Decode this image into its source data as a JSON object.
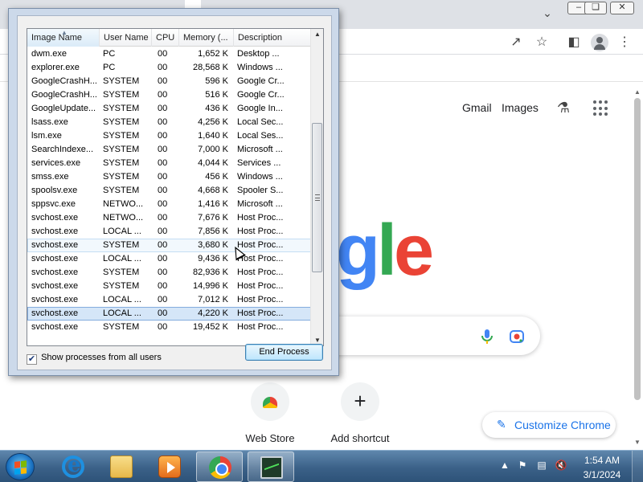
{
  "chrome": {
    "top_links": {
      "gmail": "Gmail",
      "images": "Images"
    },
    "shortcuts": [
      {
        "label": "Web Store"
      },
      {
        "label": "Add shortcut"
      }
    ],
    "customize_label": "Customize Chrome",
    "logo_letters": [
      "g",
      "l",
      "e"
    ],
    "icons": [
      "share-icon",
      "bookmark-star-icon",
      "side-panel-icon",
      "profile-icon",
      "more-menu-icon",
      "labs-icon",
      "apps-icon",
      "mic-icon",
      "lens-icon",
      "pencil-icon"
    ],
    "colors": {
      "blue": "#4285f4",
      "green": "#34a853",
      "red": "#ea4335",
      "accent": "#1a73e8"
    }
  },
  "taskmgr": {
    "columns": [
      "Image Name",
      "User Name",
      "CPU",
      "Memory (...",
      "Description"
    ],
    "sorted_column": "Image Name",
    "processes": [
      {
        "name": "dwm.exe",
        "user": "PC",
        "cpu": "00",
        "mem": "1,652 K",
        "desc": "Desktop ..."
      },
      {
        "name": "explorer.exe",
        "user": "PC",
        "cpu": "00",
        "mem": "28,568 K",
        "desc": "Windows ..."
      },
      {
        "name": "GoogleCrashH...",
        "user": "SYSTEM",
        "cpu": "00",
        "mem": "596 K",
        "desc": "Google Cr..."
      },
      {
        "name": "GoogleCrashH...",
        "user": "SYSTEM",
        "cpu": "00",
        "mem": "516 K",
        "desc": "Google Cr..."
      },
      {
        "name": "GoogleUpdate...",
        "user": "SYSTEM",
        "cpu": "00",
        "mem": "436 K",
        "desc": "Google In..."
      },
      {
        "name": "lsass.exe",
        "user": "SYSTEM",
        "cpu": "00",
        "mem": "4,256 K",
        "desc": "Local Sec..."
      },
      {
        "name": "lsm.exe",
        "user": "SYSTEM",
        "cpu": "00",
        "mem": "1,640 K",
        "desc": "Local Ses..."
      },
      {
        "name": "SearchIndexe...",
        "user": "SYSTEM",
        "cpu": "00",
        "mem": "7,000 K",
        "desc": "Microsoft ..."
      },
      {
        "name": "services.exe",
        "user": "SYSTEM",
        "cpu": "00",
        "mem": "4,044 K",
        "desc": "Services ..."
      },
      {
        "name": "smss.exe",
        "user": "SYSTEM",
        "cpu": "00",
        "mem": "456 K",
        "desc": "Windows ..."
      },
      {
        "name": "spoolsv.exe",
        "user": "SYSTEM",
        "cpu": "00",
        "mem": "4,668 K",
        "desc": "Spooler S..."
      },
      {
        "name": "sppsvc.exe",
        "user": "NETWO...",
        "cpu": "00",
        "mem": "1,416 K",
        "desc": "Microsoft ..."
      },
      {
        "name": "svchost.exe",
        "user": "NETWO...",
        "cpu": "00",
        "mem": "7,676 K",
        "desc": "Host Proc..."
      },
      {
        "name": "svchost.exe",
        "user": "LOCAL ...",
        "cpu": "00",
        "mem": "7,856 K",
        "desc": "Host Proc..."
      },
      {
        "name": "svchost.exe",
        "user": "SYSTEM",
        "cpu": "00",
        "mem": "3,680 K",
        "desc": "Host Proc..."
      },
      {
        "name": "svchost.exe",
        "user": "LOCAL ...",
        "cpu": "00",
        "mem": "9,436 K",
        "desc": "Host Proc..."
      },
      {
        "name": "svchost.exe",
        "user": "SYSTEM",
        "cpu": "00",
        "mem": "82,936 K",
        "desc": "Host Proc..."
      },
      {
        "name": "svchost.exe",
        "user": "SYSTEM",
        "cpu": "00",
        "mem": "14,996 K",
        "desc": "Host Proc..."
      },
      {
        "name": "svchost.exe",
        "user": "LOCAL ...",
        "cpu": "00",
        "mem": "7,012 K",
        "desc": "Host Proc..."
      },
      {
        "name": "svchost.exe",
        "user": "LOCAL ...",
        "cpu": "00",
        "mem": "4,220 K",
        "desc": "Host Proc..."
      },
      {
        "name": "svchost.exe",
        "user": "SYSTEM",
        "cpu": "00",
        "mem": "19,452 K",
        "desc": "Host Proc..."
      }
    ],
    "hover_row": 14,
    "selected_row": 19,
    "show_all_label": "Show processes from all users",
    "show_all_checked": true,
    "end_process_label": "End Process"
  },
  "taskbar": {
    "apps": [
      "start-button",
      "internet-explorer",
      "windows-explorer",
      "media-player",
      "google-chrome",
      "task-manager"
    ],
    "active_apps": [
      "google-chrome",
      "task-manager"
    ],
    "tray_icons": [
      "show-hidden-icons",
      "action-center-flag-icon",
      "network-icon",
      "volume-muted-icon"
    ],
    "time": "1:54 AM",
    "date": "3/1/2024"
  }
}
